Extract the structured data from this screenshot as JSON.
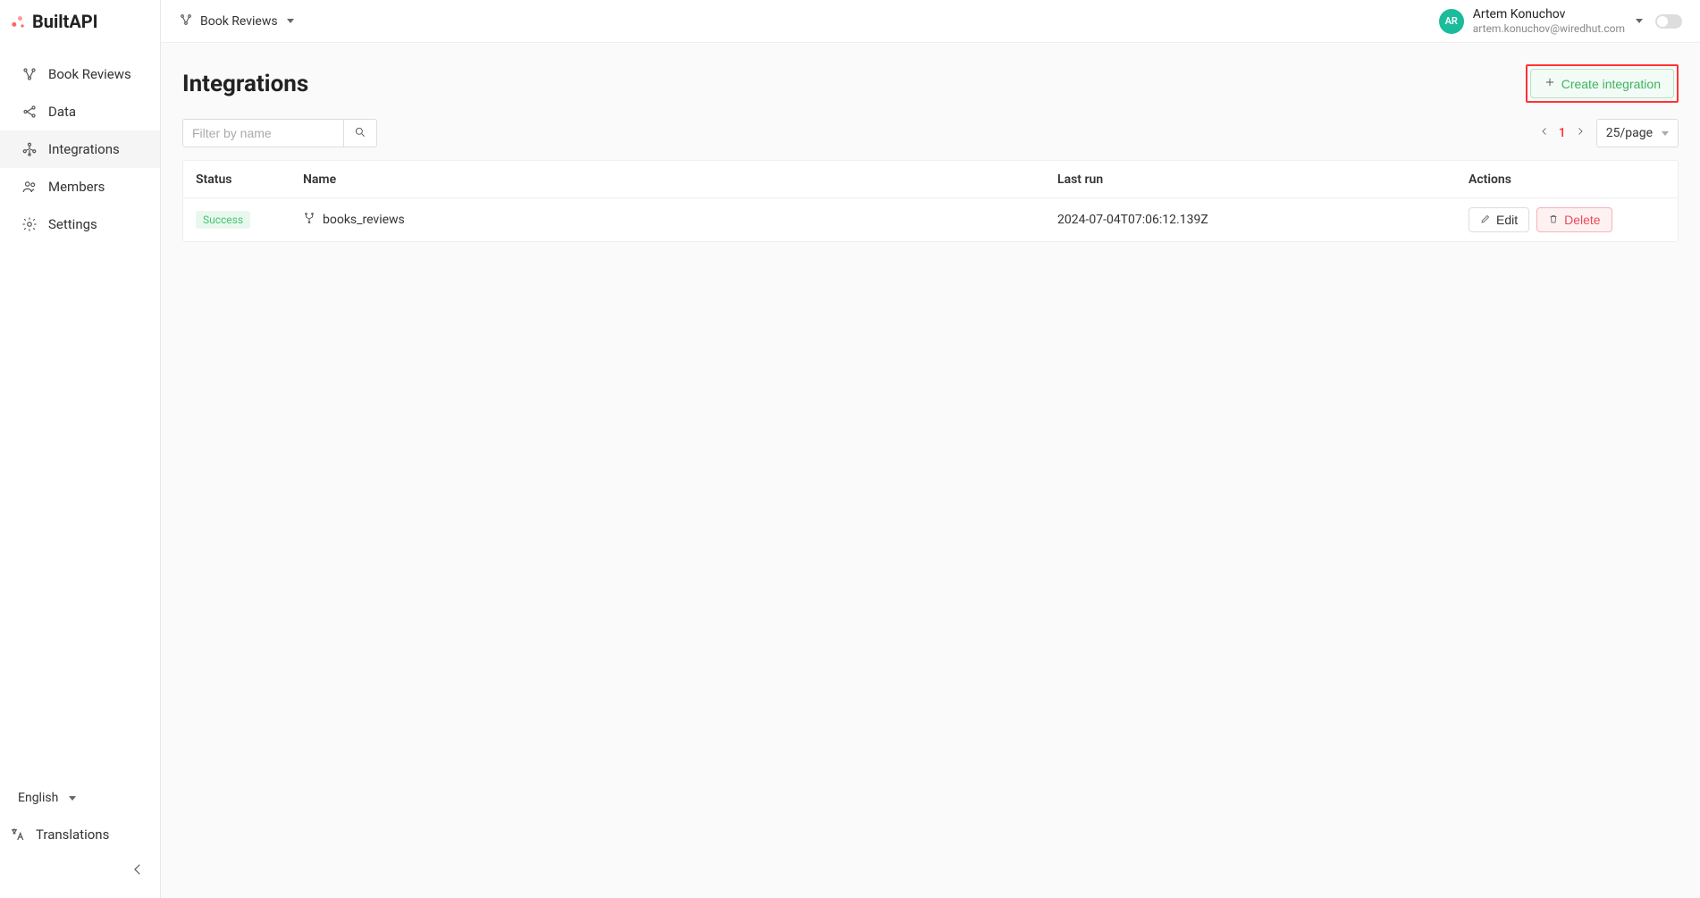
{
  "logo": {
    "text": "BuiltAPI"
  },
  "sidebar": {
    "items": [
      {
        "label": "Book Reviews"
      },
      {
        "label": "Data"
      },
      {
        "label": "Integrations"
      },
      {
        "label": "Members"
      },
      {
        "label": "Settings"
      }
    ],
    "bottom": {
      "language_label": "English",
      "translations_label": "Translations"
    }
  },
  "topbar": {
    "project_label": "Book Reviews",
    "user": {
      "initials": "AR",
      "name": "Artem Konuchov",
      "email": "artem.konuchov@wiredhut.com"
    }
  },
  "page": {
    "title": "Integrations",
    "create_button_label": "Create integration",
    "filter_placeholder": "Filter by name",
    "pagination": {
      "current_page": "1",
      "page_size_label": "25/page"
    },
    "table": {
      "headers": {
        "status": "Status",
        "name": "Name",
        "last_run": "Last run",
        "actions": "Actions"
      },
      "rows": [
        {
          "status": "Success",
          "name": "books_reviews",
          "last_run": "2024-07-04T07:06:12.139Z",
          "edit_label": "Edit",
          "delete_label": "Delete"
        }
      ]
    }
  },
  "colors": {
    "accent_green": "#3cb35f",
    "accent_red": "#e74c5b",
    "highlight_border": "#f33"
  }
}
